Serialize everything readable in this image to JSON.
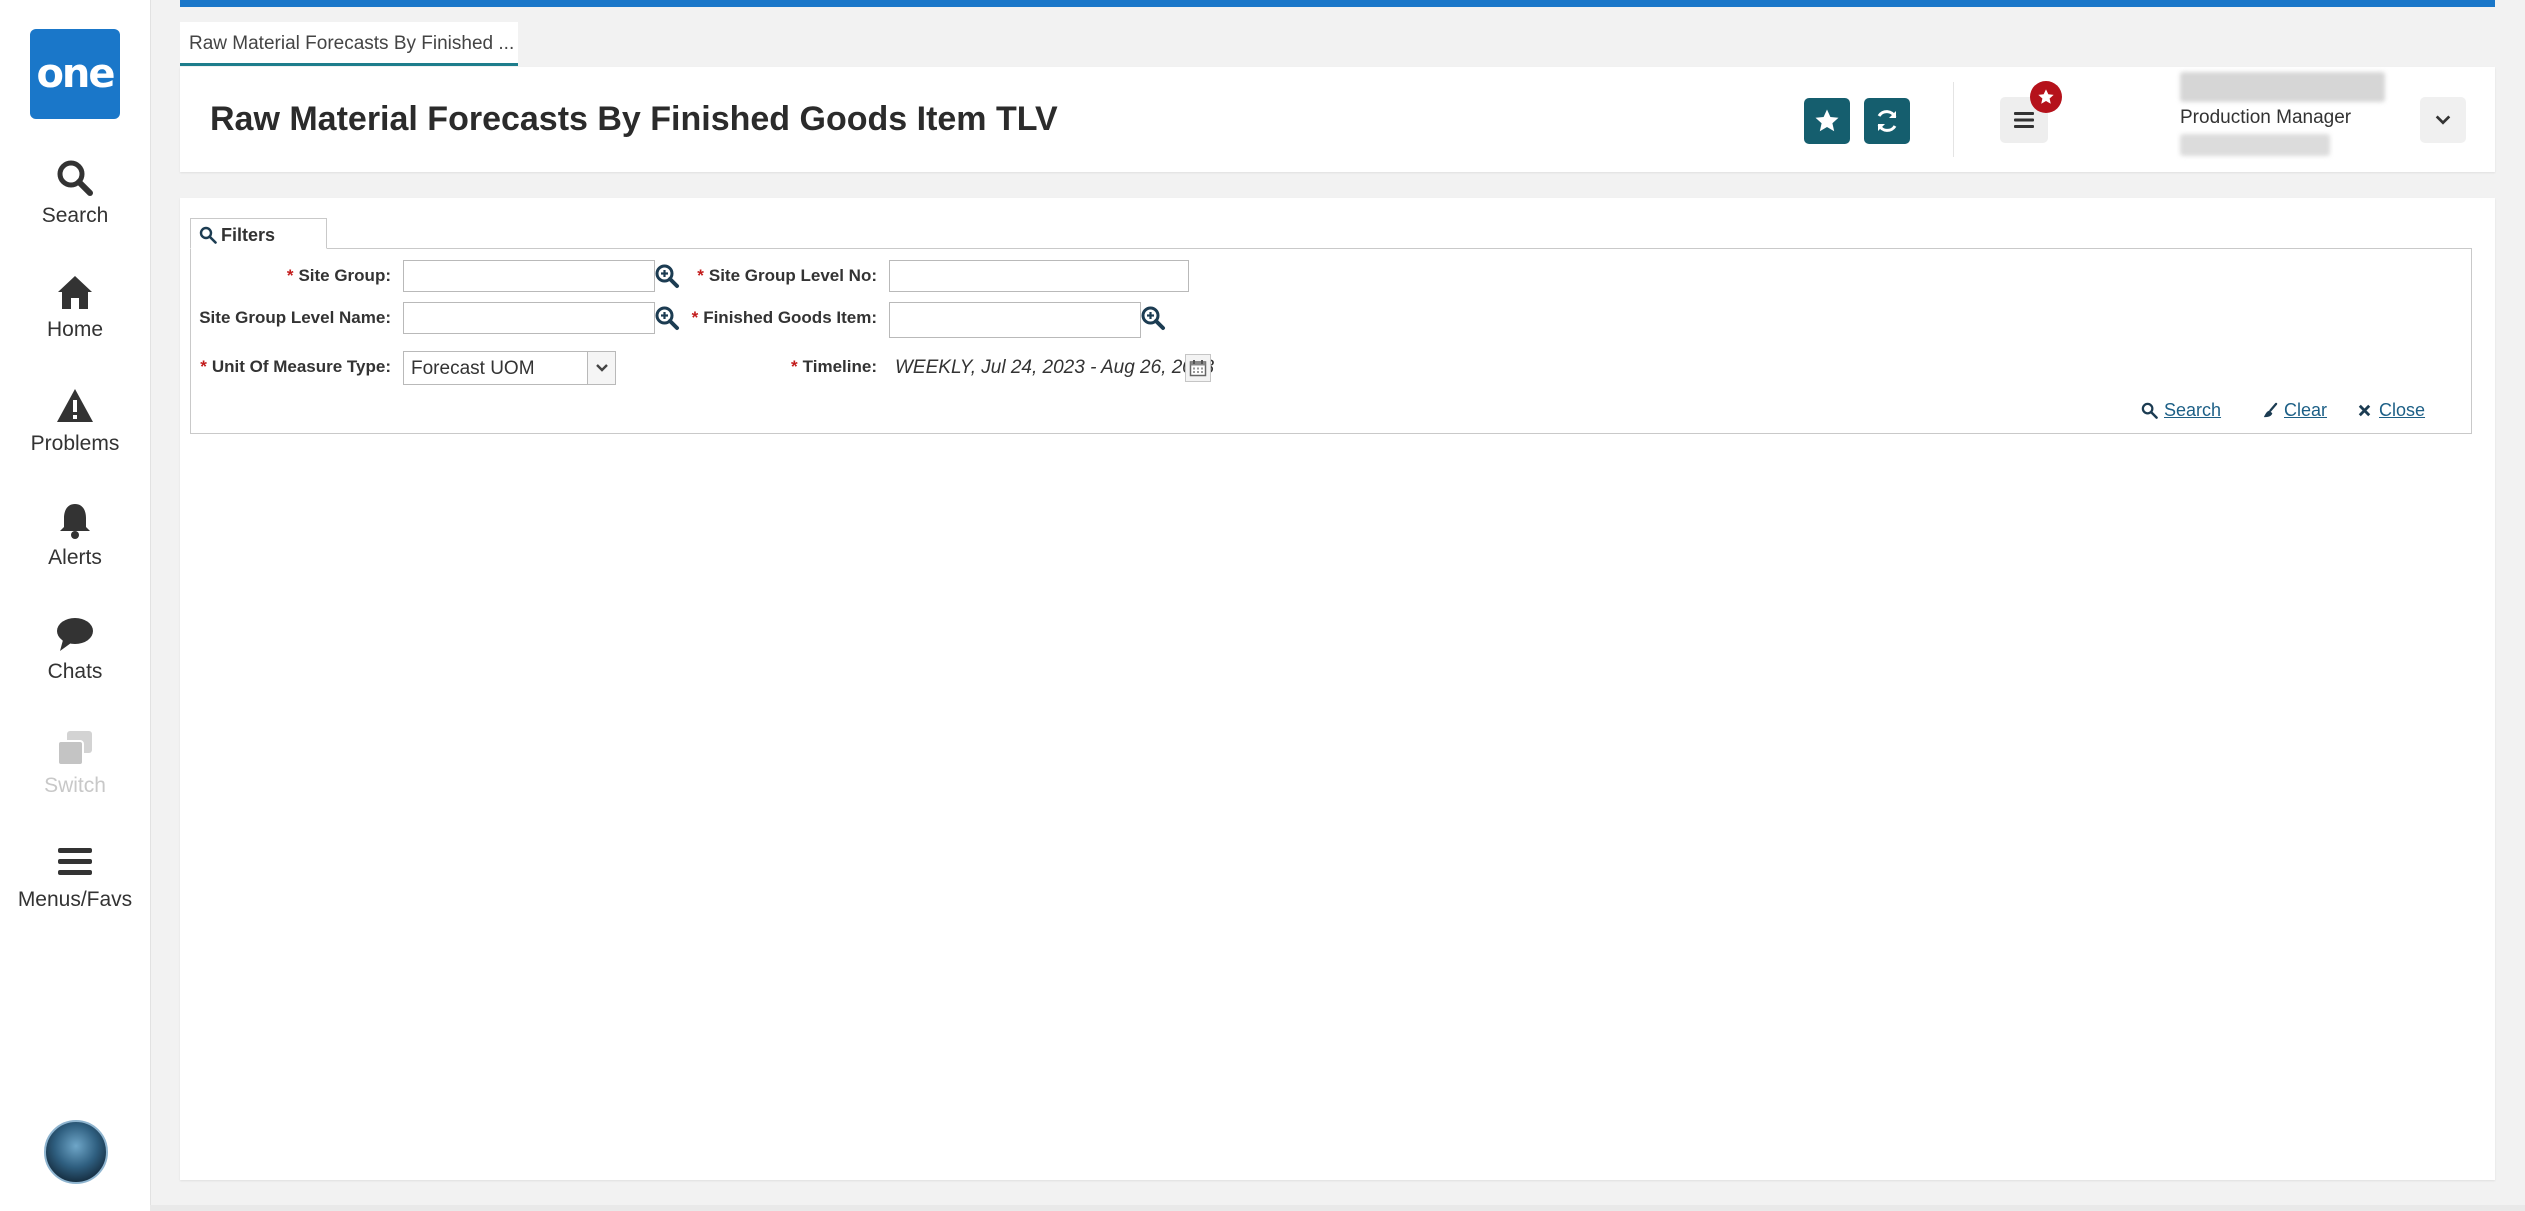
{
  "sidebar": {
    "logo_text": "one",
    "items": [
      {
        "label": "Search",
        "icon": "search-icon"
      },
      {
        "label": "Home",
        "icon": "home-icon"
      },
      {
        "label": "Problems",
        "icon": "warning-icon"
      },
      {
        "label": "Alerts",
        "icon": "bell-icon"
      },
      {
        "label": "Chats",
        "icon": "chat-bubble-icon"
      },
      {
        "label": "Switch",
        "icon": "switch-windows-icon",
        "disabled": true
      },
      {
        "label": "Menus/Favs",
        "icon": "hamburger-menu-icon"
      }
    ]
  },
  "tab": {
    "label": "Raw Material Forecasts By Finished ..."
  },
  "header": {
    "title": "Raw Material Forecasts By Finished Goods Item TLV",
    "user_role": "Production Manager",
    "colors": {
      "accent": "#155e6e",
      "brand": "#1a77c9",
      "badge": "#b5121b"
    }
  },
  "filters": {
    "tab_label": "Filters",
    "site_group": {
      "label": "Site Group:",
      "value": "",
      "required": true
    },
    "site_group_level_no": {
      "label": "Site Group Level No:",
      "value": "",
      "required": true
    },
    "site_group_level_name": {
      "label": "Site Group Level Name:",
      "value": "",
      "required": false
    },
    "finished_goods_item": {
      "label": "Finished Goods Item:",
      "value": "",
      "required": true
    },
    "unit_of_measure_type": {
      "label": "Unit Of Measure Type:",
      "value": "Forecast UOM",
      "required": true
    },
    "timeline": {
      "label": "Timeline:",
      "value": "WEEKLY, Jul 24, 2023 - Aug 26, 2023",
      "required": true
    },
    "required_mark": "*",
    "actions": {
      "search": "Search",
      "clear": "Clear",
      "close": "Close"
    }
  }
}
